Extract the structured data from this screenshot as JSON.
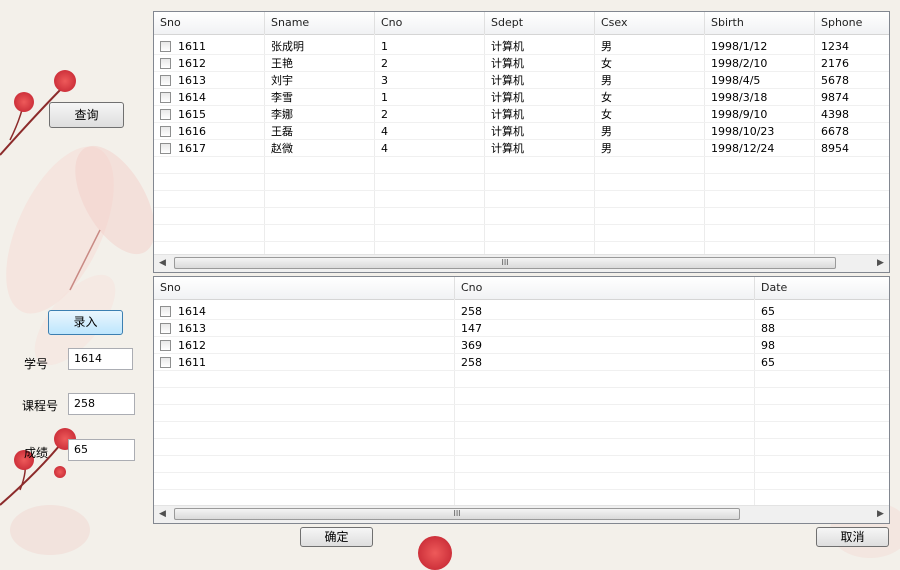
{
  "buttons": {
    "query": "查询",
    "enter": "录入",
    "confirm": "确定",
    "cancel": "取消"
  },
  "form": {
    "sno_label": "学号",
    "sno_value": "1614",
    "cno_label": "课程号",
    "cno_value": "258",
    "grade_label": "成绩",
    "grade_value": "65"
  },
  "student_table": {
    "columns": [
      "Sno",
      "Sname",
      "Cno",
      "Sdept",
      "Csex",
      "Sbirth",
      "Sphone"
    ],
    "rows": [
      [
        "1611",
        "张成明",
        "1",
        "计算机",
        "男",
        "1998/1/12",
        "1234"
      ],
      [
        "1612",
        "王艳",
        "2",
        "计算机",
        "女",
        "1998/2/10",
        "2176"
      ],
      [
        "1613",
        "刘宇",
        "3",
        "计算机",
        "男",
        "1998/4/5",
        "5678"
      ],
      [
        "1614",
        "李雪",
        "1",
        "计算机",
        "女",
        "1998/3/18",
        "9874"
      ],
      [
        "1615",
        "李娜",
        "2",
        "计算机",
        "女",
        "1998/9/10",
        "4398"
      ],
      [
        "1616",
        "王磊",
        "4",
        "计算机",
        "男",
        "1998/10/23",
        "6678"
      ],
      [
        "1617",
        "赵微",
        "4",
        "计算机",
        "男",
        "1998/12/24",
        "8954"
      ]
    ],
    "scroll_thumb": "III"
  },
  "score_table": {
    "columns": [
      "Sno",
      "Cno",
      "Date"
    ],
    "rows": [
      [
        "1614",
        "258",
        "65"
      ],
      [
        "1613",
        "147",
        "88"
      ],
      [
        "1612",
        "369",
        "98"
      ],
      [
        "1611",
        "258",
        "65"
      ]
    ],
    "scroll_thumb": "III"
  },
  "icons": {
    "scroll_left": "scroll-left-arrow-icon",
    "scroll_right": "scroll-right-arrow-icon"
  },
  "colors": {
    "background": "#f3f0ea",
    "flower_red": "#d9344a",
    "petal_pink": "#f3cfca",
    "button_blue": "#bee6fd"
  }
}
